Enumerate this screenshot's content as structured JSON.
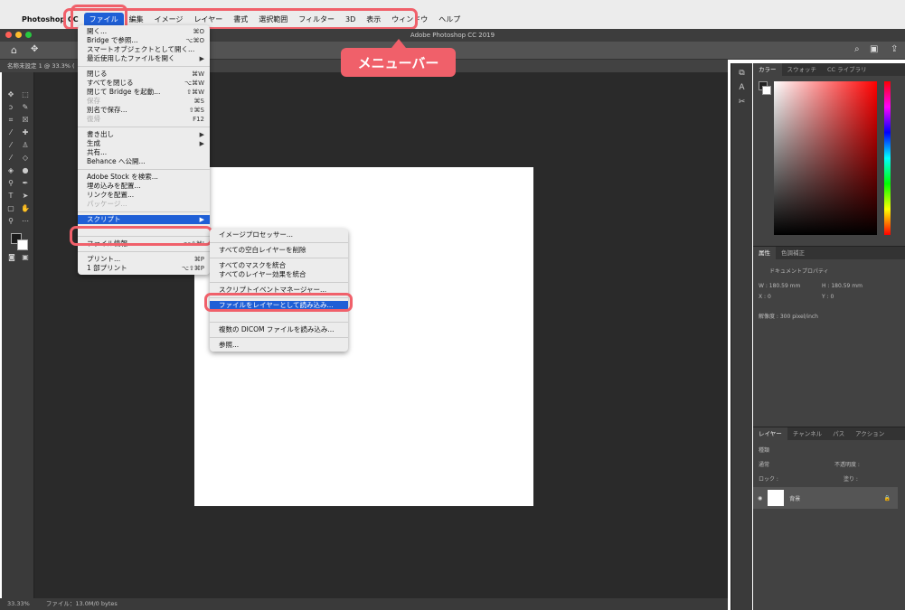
{
  "menubar": {
    "apple": "",
    "app": "Photoshop CC",
    "items": [
      "ファイル",
      "編集",
      "イメージ",
      "レイヤー",
      "書式",
      "選択範囲",
      "フィルター",
      "3D",
      "表示",
      "ウィンドウ",
      "ヘルプ"
    ]
  },
  "callout": "メニューバー",
  "window_title": "Adobe Photoshop CC 2019",
  "doc_tab": "名称未設定 1 @ 33.3% (",
  "status": {
    "zoom": "33.33%",
    "file": "ファイル：13.0M/0 bytes"
  },
  "file_menu": [
    {
      "label": "開く...",
      "sc": "⌘O"
    },
    {
      "label": "Bridge で参照...",
      "sc": "⌥⌘O"
    },
    {
      "label": "スマートオブジェクトとして開く...",
      "sc": ""
    },
    {
      "label": "最近使用したファイルを開く",
      "sc": "▶"
    },
    {
      "sep": true
    },
    {
      "label": "閉じる",
      "sc": "⌘W"
    },
    {
      "label": "すべてを閉じる",
      "sc": "⌥⌘W"
    },
    {
      "label": "閉じて Bridge を起動...",
      "sc": "⇧⌘W"
    },
    {
      "label": "保存",
      "sc": "⌘S",
      "dis": true
    },
    {
      "label": "別名で保存...",
      "sc": "⇧⌘S"
    },
    {
      "label": "復帰",
      "sc": "F12",
      "dis": true
    },
    {
      "sep": true
    },
    {
      "label": "書き出し",
      "sc": "▶"
    },
    {
      "label": "生成",
      "sc": "▶"
    },
    {
      "label": "共有...",
      "sc": ""
    },
    {
      "label": "Behance へ公開...",
      "sc": ""
    },
    {
      "sep": true
    },
    {
      "label": "Adobe Stock を検索...",
      "sc": ""
    },
    {
      "label": "埋め込みを配置...",
      "sc": ""
    },
    {
      "label": "リンクを配置...",
      "sc": ""
    },
    {
      "label": "パッケージ...",
      "sc": "",
      "dis": true
    },
    {
      "sep": true
    },
    {
      "label": "スクリプト",
      "sc": "▶",
      "sel": true
    },
    {
      "label": "",
      "sc": ""
    },
    {
      "sep": true
    },
    {
      "label": "ファイル情報...",
      "sc": "⌥⇧⌘I"
    },
    {
      "sep": true
    },
    {
      "label": "プリント...",
      "sc": "⌘P"
    },
    {
      "label": "1 部プリント",
      "sc": "⌥⇧⌘P"
    }
  ],
  "script_menu": [
    {
      "label": "イメージプロセッサー..."
    },
    {
      "sep": true
    },
    {
      "label": "すべての空白レイヤーを削除"
    },
    {
      "sep": true
    },
    {
      "label": "すべてのマスクを統合"
    },
    {
      "label": "すべてのレイヤー効果を統合"
    },
    {
      "sep": true
    },
    {
      "label": "スクリプトイベントマネージャー..."
    },
    {
      "sep": true
    },
    {
      "label": "ファイルをレイヤーとして読み込み...",
      "sel": true
    },
    {
      "label": ""
    },
    {
      "sep": true
    },
    {
      "label": "複数の DICOM ファイルを読み込み..."
    },
    {
      "sep": true
    },
    {
      "label": "参照..."
    }
  ],
  "panels": {
    "color_tabs": [
      "カラー",
      "スウォッチ",
      "CC ライブラリ"
    ],
    "props_tabs": [
      "属性",
      "色調補正"
    ],
    "props_title": "ドキュメントプロパティ",
    "w": "W : 180.59 mm",
    "h": "H : 180.59 mm",
    "x": "X : 0",
    "y": "Y : 0",
    "res": "解像度 : 300 pixel/inch",
    "layer_tabs": [
      "レイヤー",
      "チャンネル",
      "パス",
      "アクション"
    ],
    "search": "種類",
    "blend": "通常",
    "opacity": "不透明度 :",
    "lock": "ロック :",
    "fill": "塗り :",
    "layer_name": "背景"
  },
  "colors": {
    "accent": "#1f5fd6",
    "highlight": "#f0606a"
  }
}
